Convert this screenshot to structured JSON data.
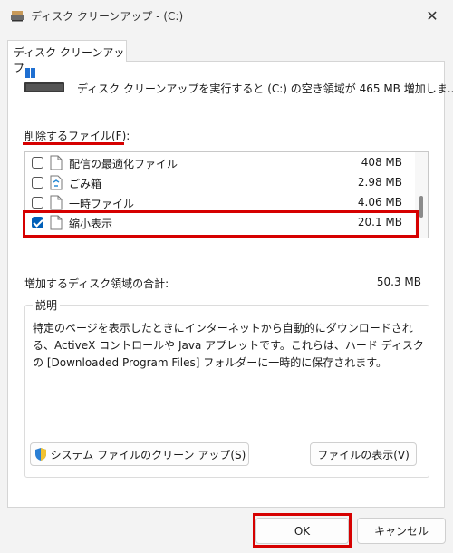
{
  "window": {
    "title": "ディスク クリーンアップ - (C:)",
    "close_glyph": "✕"
  },
  "tab": {
    "label": "ディスク クリーンアップ"
  },
  "summary": {
    "text": "ディスク クリーンアップを実行すると (C:) の空き領域が 465 MB 増加しま..."
  },
  "files": {
    "label": "削除するファイル(F):",
    "items": [
      {
        "name": "配信の最適化ファイル",
        "size": "408 MB",
        "checked": false,
        "icon": "file-icon"
      },
      {
        "name": "ごみ箱",
        "size": "2.98 MB",
        "checked": false,
        "icon": "recycle-bin-icon"
      },
      {
        "name": "一時ファイル",
        "size": "4.06 MB",
        "checked": false,
        "icon": "file-icon"
      },
      {
        "name": "縮小表示",
        "size": "20.1 MB",
        "checked": true,
        "icon": "file-icon"
      }
    ]
  },
  "total": {
    "label": "増加するディスク領域の合計:",
    "value": "50.3 MB"
  },
  "description": {
    "title": "説明",
    "text": "特定のページを表示したときにインターネットから自動的にダウンロードされる、ActiveX コントロールや Java アプレットです。これらは、ハード ディスクの [Downloaded Program Files] フォルダーに一時的に保存されます。"
  },
  "buttons": {
    "cleanup_system": "システム ファイルのクリーン アップ(S)",
    "view_files": "ファイルの表示(V)",
    "ok": "OK",
    "cancel": "キャンセル"
  },
  "colors": {
    "accent": "#005fb8",
    "highlight": "#d60000"
  }
}
